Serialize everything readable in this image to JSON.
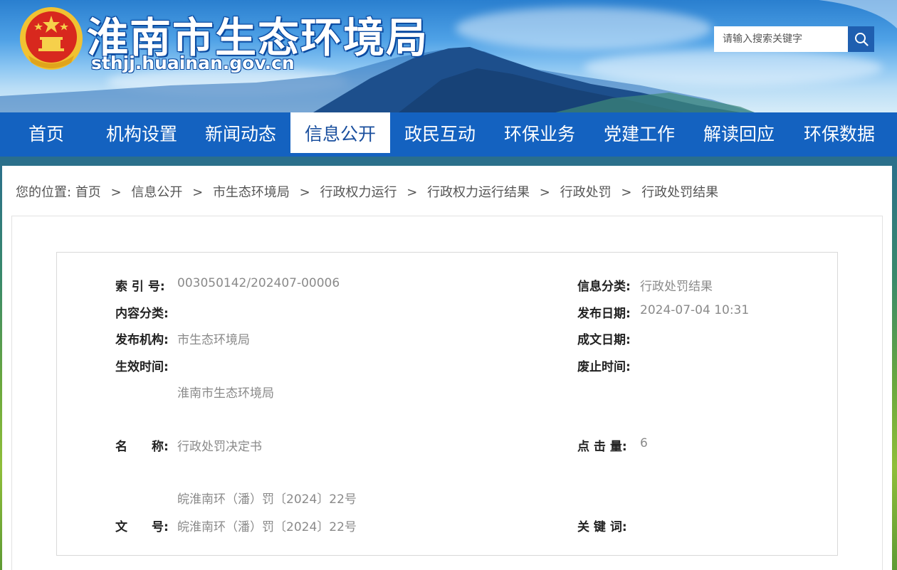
{
  "header": {
    "title": "淮南市生态环境局",
    "domain": "sthjj.huainan.gov.cn",
    "search_placeholder": "请输入搜索关键字"
  },
  "nav": {
    "items": [
      {
        "label": "首页",
        "active": false
      },
      {
        "label": "机构设置",
        "active": false
      },
      {
        "label": "新闻动态",
        "active": false
      },
      {
        "label": "信息公开",
        "active": true
      },
      {
        "label": "政民互动",
        "active": false
      },
      {
        "label": "环保业务",
        "active": false
      },
      {
        "label": "党建工作",
        "active": false
      },
      {
        "label": "解读回应",
        "active": false
      },
      {
        "label": "环保数据",
        "active": false
      }
    ]
  },
  "breadcrumb": {
    "prefix": "您的位置:",
    "items": [
      "首页",
      "信息公开",
      "市生态环境局",
      "行政权力运行",
      "行政权力运行结果",
      "行政处罚",
      "行政处罚结果"
    ],
    "separator": ">"
  },
  "info": {
    "index_label": "索 引 号:",
    "index_value": "003050142/202407-00006",
    "category_label": "信息分类:",
    "category_value": "行政处罚结果",
    "content_type_label": "内容分类:",
    "content_type_value": "",
    "publish_date_label": "发布日期:",
    "publish_date_value": "2024-07-04 10:31",
    "publisher_label": "发布机构:",
    "publisher_value": "市生态环境局",
    "doc_date_label": "成文日期:",
    "doc_date_value": "",
    "effective_label": "生效时间:",
    "effective_value": "",
    "abolish_label": "废止时间:",
    "abolish_value": "",
    "org_value": "淮南市生态环境局",
    "name_label": "名　　称:",
    "name_value": "行政处罚决定书",
    "clicks_label": "点 击 量:",
    "clicks_value": "6",
    "doc_number_extra": "皖淮南环（潘）罚〔2024〕22号",
    "doc_number_label": "文　　号:",
    "doc_number_value": "皖淮南环（潘）罚〔2024〕22号",
    "keywords_label": "关 键 词:",
    "keywords_value": ""
  },
  "colors": {
    "nav_bg": "#1462c0",
    "nav_active_text": "#1a4f9e",
    "search_button": "#1f5fb0",
    "label_text": "#222222",
    "value_text": "#8a8a8a"
  }
}
